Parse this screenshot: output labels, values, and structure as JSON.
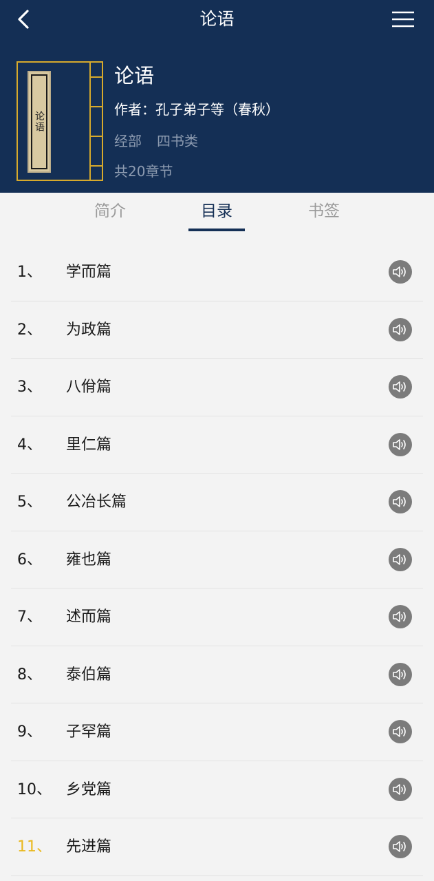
{
  "nav": {
    "title": "论语"
  },
  "book": {
    "cover_text": "论语",
    "title": "论语",
    "author": "作者：孔子弟子等（春秋）",
    "category1": "经部",
    "category2": "四书类",
    "chapter_count": "共20章节"
  },
  "tabs": [
    {
      "label": "简介"
    },
    {
      "label": "目录"
    },
    {
      "label": "书签"
    }
  ],
  "chapters": [
    {
      "num": "1、",
      "name": "学而篇"
    },
    {
      "num": "2、",
      "name": "为政篇"
    },
    {
      "num": "3、",
      "name": "八佾篇"
    },
    {
      "num": "4、",
      "name": "里仁篇"
    },
    {
      "num": "5、",
      "name": "公冶长篇"
    },
    {
      "num": "6、",
      "name": "雍也篇"
    },
    {
      "num": "7、",
      "name": "述而篇"
    },
    {
      "num": "8、",
      "name": "泰伯篇"
    },
    {
      "num": "9、",
      "name": "子罕篇"
    },
    {
      "num": "10、",
      "name": "乡党篇"
    },
    {
      "num": "11、",
      "name": "先进篇"
    }
  ],
  "icons": {
    "back": "back-arrow-icon",
    "menu": "hamburger-menu-icon",
    "audio": "speaker-icon"
  },
  "colors": {
    "header_bg": "#142f55",
    "accent_gold": "#d7aa2c",
    "highlight": "#e9b81e",
    "muted": "#8d9bb0"
  }
}
